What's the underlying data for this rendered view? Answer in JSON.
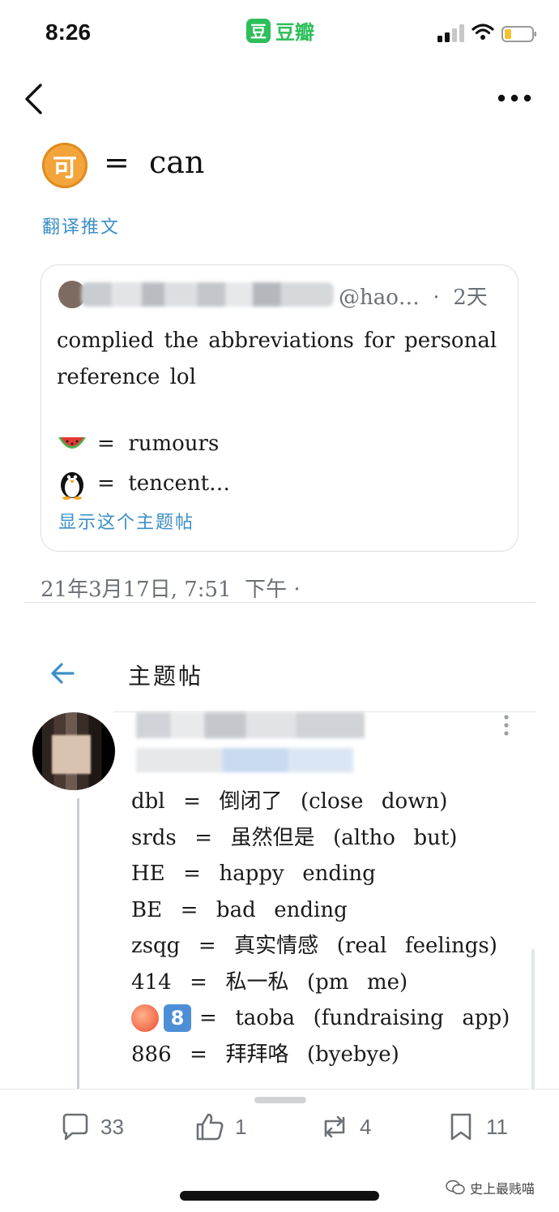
{
  "status_bar": {
    "time": "8:26",
    "app_badge": "豆",
    "app_name": "豆瓣"
  },
  "tweet": {
    "avatar_char": "可",
    "text": "=  can",
    "translate_label": "翻译推文",
    "quoted": {
      "handle_meta": "@hao…  ·  2天",
      "body": "complied the abbreviations for personal reference lol",
      "line1_text": "=  rumours",
      "line2_text": "=  tencent…",
      "show_thread_label": "显示这个主题帖"
    },
    "timestamp": "21年3月17日, 7:51  下午 ·"
  },
  "thread": {
    "title": "主题帖",
    "entries": [
      "dbl  =  倒闭了  (close  down)",
      "srds  =  虽然但是  (altho  but)",
      "HE  =  happy  ending",
      "BE  =  bad  ending",
      "zsqg  =  真实情感  (real  feelings)",
      "414  =  私一私  (pm  me)",
      "=  taoba  (fundraising  app)",
      "886  =  拜拜咯  (byebye)"
    ],
    "eight_badge": "8"
  },
  "actions": {
    "replies": "33",
    "likes": "1",
    "retweets": "4",
    "bookmarks": "11"
  },
  "watermark": "史上最贱喵",
  "colors": {
    "link": "#3a8fc7",
    "douban_green": "#2dbf5a",
    "meta_gray": "#6b7076"
  }
}
